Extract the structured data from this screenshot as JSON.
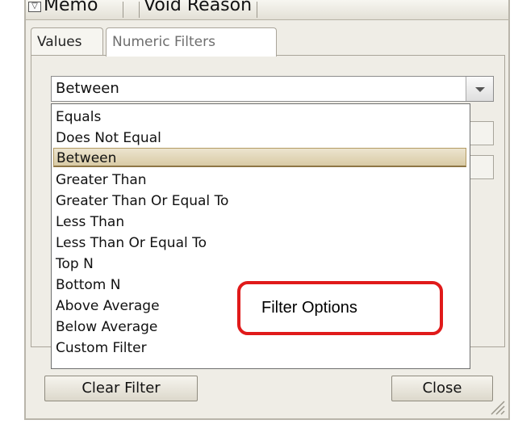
{
  "column_header": {
    "filter_icon": "column-filter-icon",
    "columns": [
      "Memo",
      "Void Reason"
    ]
  },
  "tabs": [
    {
      "label": "Values",
      "active": false
    },
    {
      "label": "Numeric Filters",
      "active": true
    }
  ],
  "combo": {
    "selected_value": "Between"
  },
  "dropdown": {
    "options": [
      "Equals",
      "Does Not Equal",
      "Between",
      "Greater Than",
      "Greater Than Or Equal To",
      "Less Than",
      "Less Than Or Equal To",
      "Top N",
      "Bottom N",
      "Above Average",
      "Below Average",
      "Custom Filter"
    ],
    "selected_index": 2
  },
  "buttons": {
    "clear_filter": "Clear Filter",
    "close": "Close"
  },
  "annotation": {
    "label": "Filter Options",
    "border_color": "#e01a1a"
  },
  "colors": {
    "selected_highlight": "#d9cba5",
    "panel_bg": "#efede6"
  }
}
